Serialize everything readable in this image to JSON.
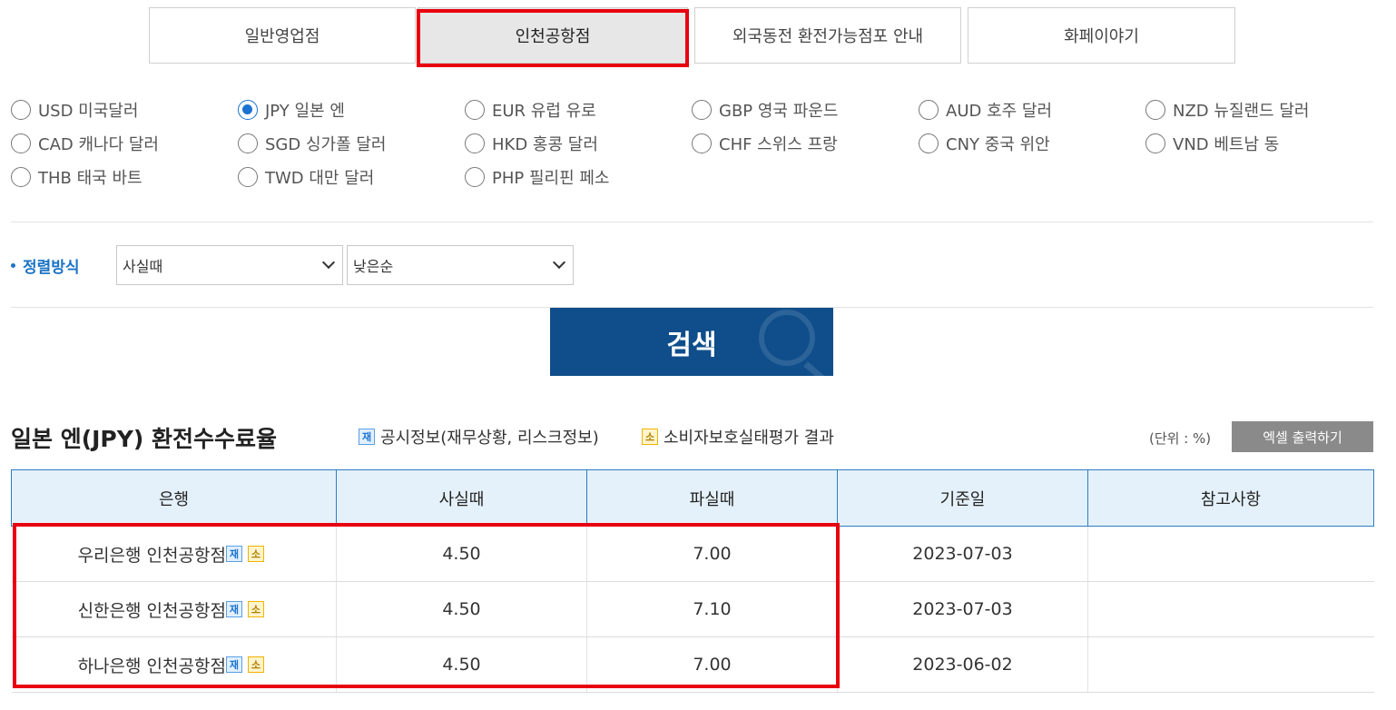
{
  "tabs": [
    {
      "label": "일반영업점"
    },
    {
      "label": "인천공항점"
    },
    {
      "label": "외국동전 환전가능점포 안내"
    },
    {
      "label": "화페이야기"
    }
  ],
  "currencies": [
    {
      "label": "USD  미국달러"
    },
    {
      "label": "JPY  일본 엔"
    },
    {
      "label": "EUR  유럽 유로"
    },
    {
      "label": "GBP  영국 파운드"
    },
    {
      "label": "AUD  호주 달러"
    },
    {
      "label": "NZD  뉴질랜드 달러"
    },
    {
      "label": "CAD  캐나다 달러"
    },
    {
      "label": "SGD  싱가폴 달러"
    },
    {
      "label": "HKD  홍콩 달러"
    },
    {
      "label": "CHF  스위스 프랑"
    },
    {
      "label": "CNY  중국 위안"
    },
    {
      "label": "VND  베트남 동"
    },
    {
      "label": "THB  태국 바트"
    },
    {
      "label": "TWD  대만 달러"
    },
    {
      "label": "PHP  필리핀 페소"
    }
  ],
  "selected_currency": "JPY",
  "sort": {
    "label": "정렬방식",
    "field": "사실때",
    "order": "낮은순"
  },
  "search": {
    "label": "검색"
  },
  "section": {
    "title": "일본 엔(JPY) 환전수수료율",
    "badge_disclosure": "재",
    "disclosure_label": "공시정보(재무상황, 리스크정보)",
    "badge_consumer": "소",
    "consumer_label": "소비자보호실태평가 결과",
    "unit": "(단위 : %)",
    "excel_label": "엑셀 출력하기"
  },
  "table": {
    "headers": [
      "은행",
      "사실때",
      "파실때",
      "기준일",
      "참고사항"
    ],
    "rows": [
      {
        "bank": "우리은행 인천공항점",
        "buy": "4.50",
        "sell": "7.00",
        "date": "2023-07-03",
        "note": ""
      },
      {
        "bank": "신한은행 인천공항점",
        "buy": "4.50",
        "sell": "7.10",
        "date": "2023-07-03",
        "note": ""
      },
      {
        "bank": "하나은행 인천공항점",
        "buy": "4.50",
        "sell": "7.00",
        "date": "2023-06-02",
        "note": ""
      }
    ]
  },
  "colors": {
    "highlight": "#e8000f",
    "accent": "#1a73c6",
    "search_bg": "#0f4e8a",
    "header_bg": "#e5f1fa"
  }
}
